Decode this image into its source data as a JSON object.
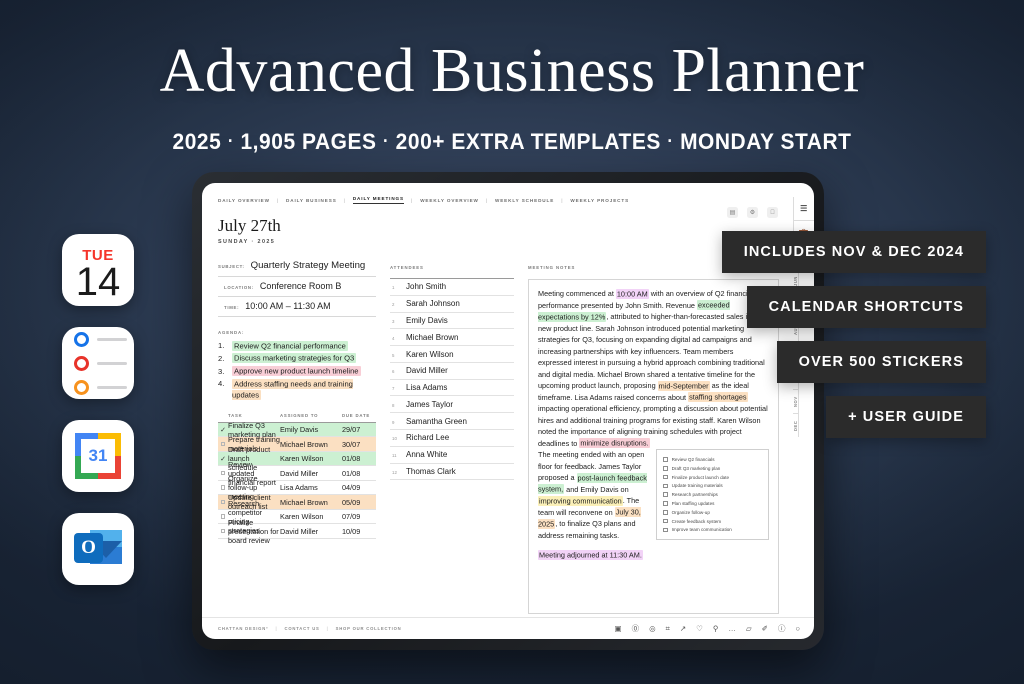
{
  "hero": {
    "title": "Advanced Business Planner",
    "subtitle_parts": [
      "2025",
      "1,905 PAGES",
      "200+ EXTRA TEMPLATES",
      "MONDAY START"
    ],
    "separator": "·"
  },
  "app_icons": [
    {
      "name": "apple-calendar",
      "weekday": "TUE",
      "day": "14"
    },
    {
      "name": "apple-reminders",
      "dot_colors": [
        "#1673e8",
        "#e8332a",
        "#f7921e"
      ]
    },
    {
      "name": "google-calendar",
      "day": "31"
    },
    {
      "name": "microsoft-outlook",
      "letter": "O"
    }
  ],
  "badges": [
    "INCLUDES NOV & DEC 2024",
    "CALENDAR SHORTCUTS",
    "OVER 500 STICKERS",
    "+ USER GUIDE"
  ],
  "planner": {
    "topnav": [
      {
        "label": "DAILY OVERVIEW",
        "active": false
      },
      {
        "label": "DAILY BUSINESS",
        "active": false
      },
      {
        "label": "DAILY MEETINGS",
        "active": true
      },
      {
        "label": "WEEKLY OVERVIEW",
        "active": false
      },
      {
        "label": "WEEKLY SCHEDULE",
        "active": false
      },
      {
        "label": "WEEKLY PROJECTS",
        "active": false
      }
    ],
    "date_title": "July 27th",
    "date_sub": "SUNDAY · 2025",
    "fields": [
      {
        "label": "SUBJECT:",
        "value": "Quarterly Strategy Meeting"
      },
      {
        "label": "LOCATION:",
        "value": "Conference Room B"
      },
      {
        "label": "TIME:",
        "value": "10:00 AM – 11:30 AM"
      }
    ],
    "agenda_label": "AGENDA:",
    "agenda": [
      {
        "num": "1.",
        "text": "Review Q2 financial performance",
        "highlight": "#ccf0d2"
      },
      {
        "num": "2.",
        "text": "Discuss marketing strategies for Q3",
        "highlight": "#ccf0d2"
      },
      {
        "num": "3.",
        "text": "Approve new product launch timeline",
        "highlight": "#f8ced6"
      },
      {
        "num": "4.",
        "text": "Address staffing needs and training updates",
        "highlight": "#fbe0c2"
      }
    ],
    "attendees_label": "ATTENDEES",
    "attendees": [
      {
        "i": "1",
        "name": "John Smith"
      },
      {
        "i": "2",
        "name": "Sarah Johnson"
      },
      {
        "i": "3",
        "name": "Emily Davis"
      },
      {
        "i": "4",
        "name": "Michael Brown"
      },
      {
        "i": "5",
        "name": "Karen Wilson"
      },
      {
        "i": "6",
        "name": "David Miller"
      },
      {
        "i": "7",
        "name": "Lisa Adams"
      },
      {
        "i": "8",
        "name": "James Taylor"
      },
      {
        "i": "9",
        "name": "Samantha Green"
      },
      {
        "i": "10",
        "name": "Richard Lee"
      },
      {
        "i": "11",
        "name": "Anna White"
      },
      {
        "i": "12",
        "name": "Thomas Clark"
      }
    ],
    "notes_label": "MEETING NOTES",
    "notes": {
      "p1": [
        {
          "t": "Meeting commenced at "
        },
        {
          "t": "10:00 AM",
          "hl": "#f2d3f7"
        },
        {
          "t": " with an overview of Q2 financial performance presented by John Smith. Revenue "
        },
        {
          "t": "exceeded expectations by 12%",
          "hl": "#ccf0d2"
        },
        {
          "t": ", attributed to higher-than-forecasted sales in the new product line. Sarah Johnson introduced potential marketing strategies for Q3, focusing on expanding digital ad campaigns and increasing partnerships with key influencers. Team members expressed interest in pursuing a hybrid approach combining traditional and digital media. Michael Brown shared a tentative timeline for the upcoming product launch, proposing "
        },
        {
          "t": "mid-September",
          "hl": "#fbe0c2"
        },
        {
          "t": " as the ideal timeframe. Lisa Adams raised concerns about "
        },
        {
          "t": "staffing shortages",
          "hl": "#fbe0c2"
        },
        {
          "t": " impacting operational efficiency, prompting a discussion about potential hires and additional training programs for existing staff. Karen Wilson noted the importance of aligning training schedules with project deadlines to "
        },
        {
          "t": "minimize disruptions.",
          "hl": "#f8ced6"
        }
      ],
      "p2": [
        {
          "t": "The meeting ended with an open floor for feedback. James Taylor proposed a "
        },
        {
          "t": "post-launch feedback system,",
          "hl": "#ccf0d2"
        },
        {
          "t": " and Emily Davis on "
        },
        {
          "t": "improving communication",
          "hl": "#fbf0b8"
        },
        {
          "t": ". The team will reconvene on "
        },
        {
          "t": "July 30, 2025",
          "hl": "#fbe0c2"
        },
        {
          "t": ", to finalize Q3 plans and address remaining tasks."
        }
      ],
      "p3": [
        {
          "t": "Meeting adjourned at 11:30 AM.",
          "hl": "#f2d3f7"
        }
      ]
    },
    "checklist": [
      "Review Q2 financials",
      "Draft Q3 marketing plan",
      "Finalize product launch date",
      "Update training materials",
      "Research partnerships",
      "Plan staffing updates",
      "Organize follow-up",
      "Create feedback system",
      "Improve team communication"
    ],
    "tasks_headers": {
      "task": "TASK",
      "assigned": "ASSIGNED TO",
      "due": "DUE DATE"
    },
    "tasks": [
      {
        "done": true,
        "task": "Finalize Q3 marketing plan",
        "assigned": "Emily Davis",
        "due": "29/07",
        "highlight": "#ccf0d2"
      },
      {
        "done": false,
        "task": "Prepare training materials",
        "assigned": "Michael Brown",
        "due": "30/07",
        "highlight": "#fbe0c2"
      },
      {
        "done": true,
        "task": "Draft product launch schedule",
        "assigned": "Karen Wilson",
        "due": "01/08",
        "highlight": "#ccf0d2"
      },
      {
        "done": false,
        "task": "Review updated financial report",
        "assigned": "David Miller",
        "due": "01/08",
        "highlight": ""
      },
      {
        "done": false,
        "task": "Organize follow-up meeting",
        "assigned": "Lisa Adams",
        "due": "04/09",
        "highlight": ""
      },
      {
        "done": false,
        "task": "Update client outreach list",
        "assigned": "Michael Brown",
        "due": "05/09",
        "highlight": "#fbe0c2"
      },
      {
        "done": false,
        "task": "Research competitor pricing strategies",
        "assigned": "Karen Wilson",
        "due": "07/09",
        "highlight": ""
      },
      {
        "done": false,
        "task": "Finalize presentation for board review",
        "assigned": "David Miller",
        "due": "10/09",
        "highlight": ""
      }
    ],
    "month_tabs": [
      "MAY",
      "JUN",
      "JUL",
      "AUG",
      "SEP",
      "OCT",
      "NOV",
      "DEC"
    ],
    "footer_links": [
      "CHATTAN DESIGN°",
      "CONTACT US",
      "SHOP OUR COLLECTION"
    ],
    "footer_tools": [
      "▣",
      "⓪",
      "◎",
      "⌗",
      "↗",
      "♡",
      "⚲",
      "…",
      "▱",
      "✐",
      "ⓘ",
      "○"
    ],
    "mini_icons": [
      "▤",
      "⚙",
      ""
    ]
  }
}
